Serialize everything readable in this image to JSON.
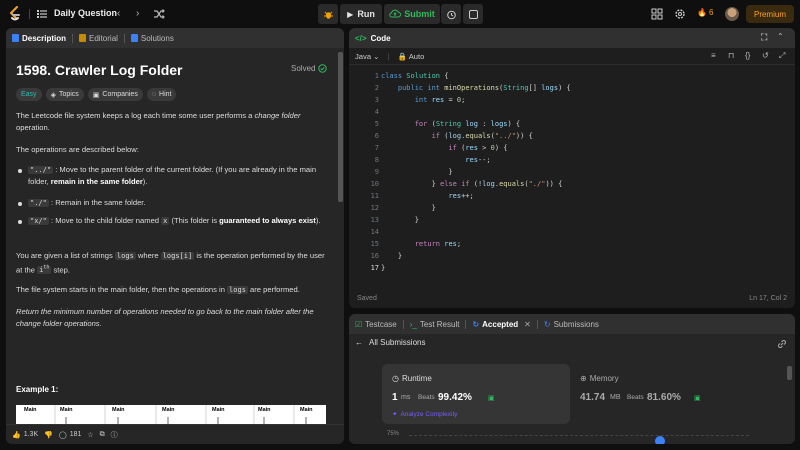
{
  "topbar": {
    "title": "Daily Question",
    "run_label": "Run",
    "submit_label": "Submit",
    "streak_count": "6",
    "premium_label": "Premium"
  },
  "left": {
    "tabs": [
      {
        "label": "Description"
      },
      {
        "label": "Editorial"
      },
      {
        "label": "Solutions"
      }
    ],
    "problem_title": "1598. Crawler Log Folder",
    "solved_label": "Solved",
    "tags": [
      "Easy",
      "Topics",
      "Companies",
      "Hint"
    ],
    "para1_a": "The Leetcode file system keeps a log each time some user performs a ",
    "para1_em": "change folder",
    "para1_b": " operation.",
    "para2": "The operations are described below:",
    "b1_code": "\"../\"",
    "b1_text": " : Move to the parent folder of the current folder. (If you are already in the main folder, ",
    "b1_bold": "remain in the same folder",
    "b1_end": ").",
    "b2_code": "\"./\"",
    "b2_text": " : Remain in the same folder.",
    "b3_code": "\"x/\"",
    "b3_text": " : Move to the child folder named ",
    "b3_code2": "x",
    "b3_text2": " (This folder is ",
    "b3_bold": "guaranteed to always exist",
    "b3_end": ").",
    "para3_a": "You are given a list of strings ",
    "para3_code1": "logs",
    "para3_b": " where ",
    "para3_code2": "logs[i]",
    "para3_c": " is the operation performed by the user at the ",
    "para3_code3": "i",
    "para3_sup": "th",
    "para3_d": " step.",
    "para4_a": "The file system starts in the main folder, then the operations in ",
    "para4_code": "logs",
    "para4_b": " are performed.",
    "para5_a": "Return the minimum number of operations needed to go back to the main folder after the change folder operations.",
    "example_label": "Example 1:",
    "diagram_labels": [
      "Main",
      "Main",
      "Main",
      "Main",
      "Main",
      "Main",
      "Main"
    ],
    "diagram_sub": [
      "d1",
      "d1",
      "d1",
      "d1",
      "d21",
      "d21",
      "d21",
      "d2",
      "d2"
    ],
    "footer": {
      "likes": "1.3K",
      "comments": "181"
    }
  },
  "code": {
    "header": "Code",
    "language": "Java",
    "auto_label": "Auto",
    "lines": [
      "1",
      "2",
      "3",
      "4",
      "5",
      "6",
      "7",
      "8",
      "9",
      "10",
      "11",
      "12",
      "13",
      "14",
      "15",
      "16",
      "17"
    ],
    "saved_label": "Saved",
    "cursor_pos": "Ln 17, Col 2"
  },
  "result": {
    "tabs": [
      "Testcase",
      "Test Result",
      "Accepted",
      "Submissions"
    ],
    "all_submissions": "All Submissions",
    "runtime_label": "Runtime",
    "runtime_value": "1",
    "runtime_unit": "ms",
    "beats_label": "Beats",
    "runtime_beats": "99.42%",
    "analyze_label": "Analyze Complexity",
    "memory_label": "Memory",
    "memory_value": "41.74",
    "memory_unit": "MB",
    "memory_beats": "81.60%",
    "pct_tick": "75%"
  },
  "colors": {
    "accent_orange": "#ffa116",
    "accepted_green": "#2cbb5d",
    "bg": "#0f0f0f",
    "panel": "#262626"
  }
}
